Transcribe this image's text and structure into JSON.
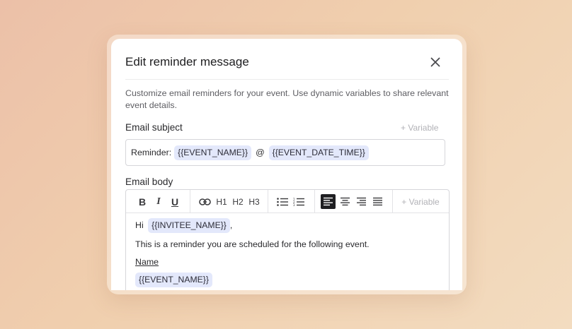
{
  "dialog": {
    "title": "Edit reminder message",
    "description": "Customize email reminders for your event. Use dynamic variables to share relevant event details."
  },
  "subject": {
    "label": "Email subject",
    "add_variable": "+ Variable",
    "prefix": "Reminder:",
    "var1": "{{EVENT_NAME}}",
    "separator": "@",
    "var2": "{{EVENT_DATE_TIME}}"
  },
  "body": {
    "label": "Email body",
    "toolbar": {
      "bold": "B",
      "italic": "I",
      "underline": "U",
      "h1": "H1",
      "h2": "H2",
      "h3": "H3",
      "add_variable": "+ Variable"
    },
    "greeting": "Hi",
    "greeting_var": "{{INVITEE_NAME}}",
    "greeting_suffix": ",",
    "paragraph": "This is a reminder you are scheduled for the following event.",
    "name_heading": "Name",
    "name_var": "{{EVENT_NAME}}"
  },
  "icons": {
    "close": "close-icon",
    "link": "link-icon",
    "bullet_list": "bullet-list-icon",
    "numbered_list": "numbered-list-icon",
    "align_left": "align-left-icon",
    "align_center": "align-center-icon",
    "align_right": "align-right-icon",
    "align_justify": "align-justify-icon"
  },
  "colors": {
    "chip_bg": "#e3e8fb",
    "muted_text": "#b2b2b7",
    "active_tool": "#1f1f22"
  }
}
